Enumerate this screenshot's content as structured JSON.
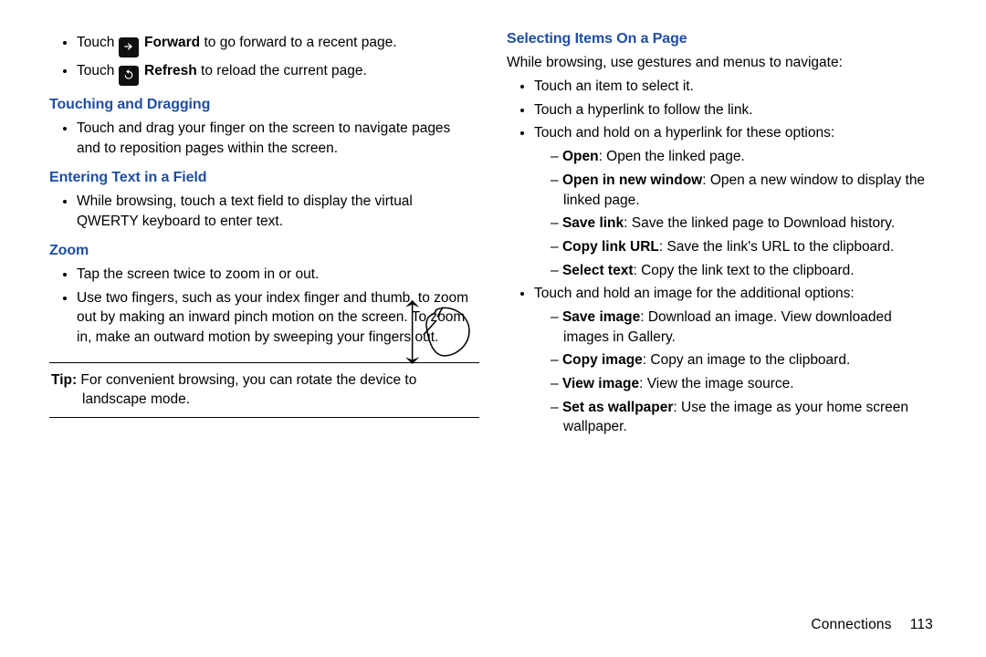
{
  "left": {
    "nav_items": [
      {
        "prefix": "Touch",
        "icon": "forward",
        "bold": "Forward",
        "rest": " to go forward to a recent page."
      },
      {
        "prefix": "Touch",
        "icon": "refresh",
        "bold": "Refresh",
        "rest": " to reload the current page."
      }
    ],
    "touch_drag": {
      "heading": "Touching and Dragging",
      "items": [
        "Touch and drag your finger on the screen to navigate pages and to reposition pages within the screen."
      ]
    },
    "enter_text": {
      "heading": "Entering Text in a Field",
      "items": [
        "While browsing, touch a text field to display the virtual QWERTY keyboard to enter text."
      ]
    },
    "zoom": {
      "heading": "Zoom",
      "items": [
        "Tap the screen twice to zoom in or out.",
        "Use two fingers, such as your index finger and thumb, to zoom out by making an inward pinch motion on the screen. To zoom in, make an outward motion by sweeping your fingers out."
      ]
    },
    "tip": {
      "label": "Tip:",
      "text_line1": " For convenient browsing, you can rotate the device to",
      "text_line2": "landscape mode."
    }
  },
  "right": {
    "selecting": {
      "heading": "Selecting Items On a Page",
      "lead": "While browsing, use gestures and menus to navigate:",
      "items": [
        "Touch an item to select it.",
        "Touch a hyperlink to follow the link.",
        "Touch and hold on a hyperlink for these options:"
      ],
      "link_options": [
        {
          "bold": "Open",
          "rest": ": Open the linked page."
        },
        {
          "bold": "Open in new window",
          "rest": ": Open a new window to display the linked page."
        },
        {
          "bold": "Save link",
          "rest": ": Save the linked page to Download history."
        },
        {
          "bold": "Copy link URL",
          "rest": ": Save the link's URL to the clipboard."
        },
        {
          "bold": "Select text",
          "rest": ": Copy the link text to the clipboard."
        }
      ],
      "img_intro": "Touch and hold an image for the additional options:",
      "img_options": [
        {
          "bold": "Save image",
          "rest": ": Download an image. View downloaded images in Gallery."
        },
        {
          "bold": "Copy image",
          "rest": ": Copy an image to the clipboard."
        },
        {
          "bold": "View image",
          "rest": ": View the image source."
        },
        {
          "bold": "Set as wallpaper",
          "rest": ": Use the image as your home screen wallpaper."
        }
      ]
    }
  },
  "footer": {
    "section": "Connections",
    "page": "113"
  }
}
